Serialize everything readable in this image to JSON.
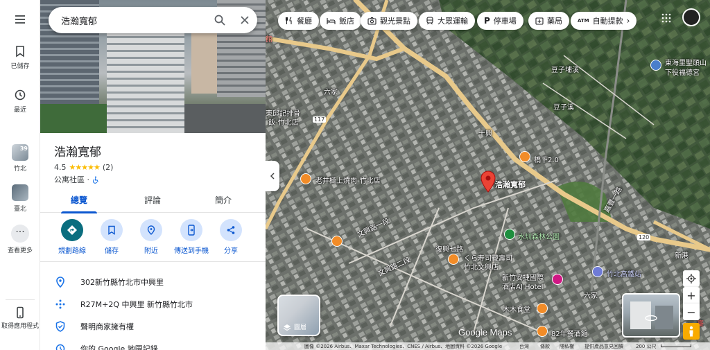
{
  "rail": {
    "menu_icon": "menu-icon",
    "saved_label": "已儲存",
    "recent_label": "最近",
    "recent_place_1": {
      "label": "竹北",
      "badge": "39"
    },
    "recent_place_2": {
      "label": "臺北"
    },
    "more_label": "查看更多",
    "get_app_label": "取得應用程式"
  },
  "search": {
    "value": "浩瀚寬郁"
  },
  "place": {
    "title": "浩瀚寬郁",
    "rating": "4.5",
    "stars": "★★★★★",
    "review_count": "(2)",
    "category": "公寓社區 ·"
  },
  "tabs": [
    {
      "label": "總覽"
    },
    {
      "label": "評論"
    },
    {
      "label": "簡介"
    }
  ],
  "actions": [
    {
      "label": "規劃路線"
    },
    {
      "label": "儲存"
    },
    {
      "label": "附近"
    },
    {
      "label": "傳送到手機"
    },
    {
      "label": "分享"
    }
  ],
  "info": {
    "address": "302新竹縣竹北市中興里",
    "plus_code": "R27M+2Q 中興里 新竹縣竹北市",
    "claim": "聲明商家擁有權",
    "history": "你的 Google 地圖記錄"
  },
  "chips": [
    {
      "label": "餐廳",
      "icon": "fork-knife-icon"
    },
    {
      "label": "飯店",
      "icon": "bed-icon"
    },
    {
      "label": "觀光景點",
      "icon": "camera-icon"
    },
    {
      "label": "大眾運輸",
      "icon": "train-icon"
    },
    {
      "label": "停車場",
      "icon": "parking-icon"
    },
    {
      "label": "藥局",
      "icon": "pharmacy-icon"
    },
    {
      "label": "自動提款",
      "icon": "atm-icon"
    }
  ],
  "map": {
    "marker_label": "浩瀚寬郁",
    "labels": {
      "l1": "六家",
      "l2": "東邱記排骨",
      "l3": "飯-竹北店",
      "l4": "十興",
      "l5": "橋下2.0",
      "l6": "老井極上燒肉-竹北店",
      "l7": "水圳森林公園",
      "l8": "くら寿司藏壽司",
      "l9": "竹北文興店",
      "l10": "新竹安捷國際",
      "l11": "酒店AJ Hotel",
      "l12": "竹北高鐵站",
      "l13": "六家",
      "l14": "木木食堂",
      "l15": "82年餐酒館",
      "l16": "東海里聖頭山",
      "l17": "下役福德宮",
      "l18": "豆子埔溪",
      "l19": "豆子溪",
      "l20": "復興七路",
      "l21": "文興路一段",
      "l22": "文興路二段",
      "l23": "嘉豐一路",
      "l24": "120",
      "l25": "117",
      "l26": "新港",
      "l27": "臺",
      "l28": "館"
    },
    "layers_label": "圖層",
    "logo": "Google Maps",
    "footer": {
      "imagery": "圖像 ©2026 Airbus、Maxar Technologies、CNES / Airbus、地圖資料 ©2026 Google",
      "region": "台灣",
      "terms": "條款",
      "privacy": "隱私權",
      "feedback": "提供產品意見回饋",
      "scale": "200 公尺"
    }
  },
  "colors": {
    "accent": "#0b57d0",
    "primary_action": "#0b6e7f",
    "marker": "#ea4335",
    "star": "#fbbc04",
    "road": "#e8c98a",
    "poi_food": "#f28c28",
    "poi_park": "#1e8e3e",
    "poi_hotel": "#d01884"
  }
}
